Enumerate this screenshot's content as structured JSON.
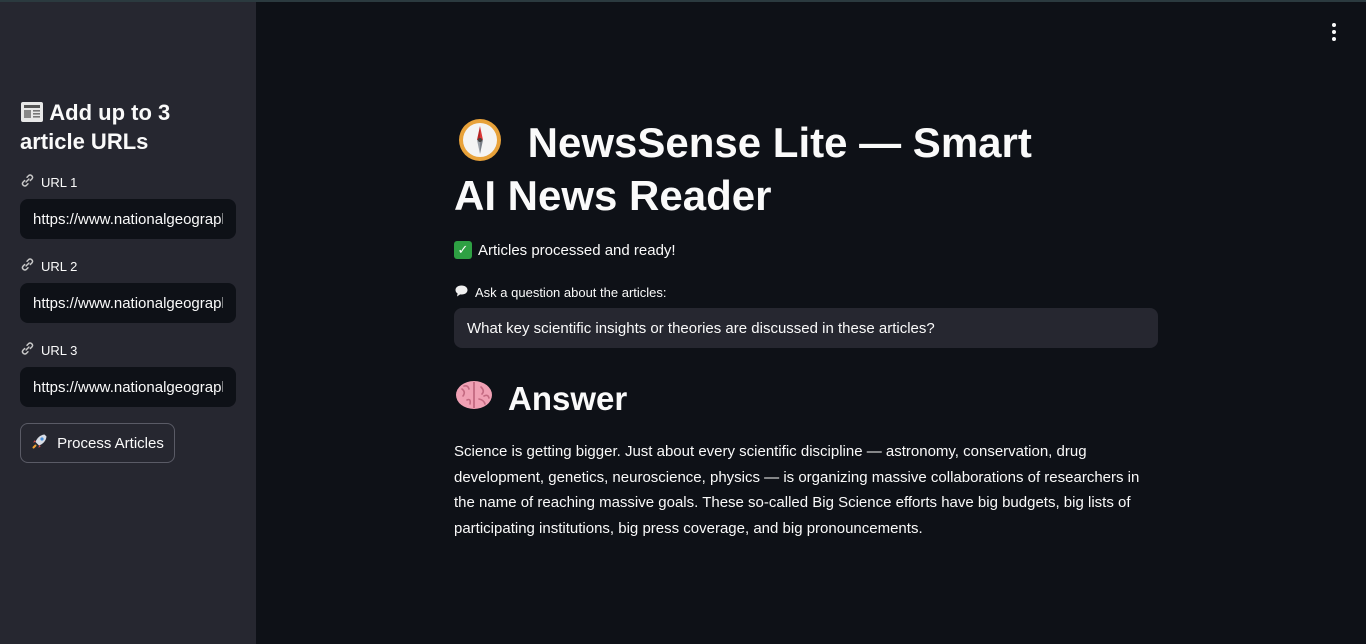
{
  "sidebar": {
    "heading_icon": "newspaper-icon",
    "heading": "Add up to 3 article URLs",
    "url_icon": "link-icon",
    "urls": [
      {
        "label": "URL 1",
        "value": "https://www.nationalgeographic.com"
      },
      {
        "label": "URL 2",
        "value": "https://www.nationalgeographic.com"
      },
      {
        "label": "URL 3",
        "value": "https://www.nationalgeographic.com"
      }
    ],
    "process_button": {
      "icon": "rocket-icon",
      "label": "Process Articles"
    }
  },
  "header": {
    "menu_icon": "kebab-menu-icon"
  },
  "main": {
    "title_icon": "compass-icon",
    "title": "NewsSense Lite — Smart AI News Reader",
    "status": {
      "icon": "check-icon",
      "text": "Articles processed and ready!"
    },
    "question": {
      "icon": "speech-bubble-icon",
      "label": "Ask a question about the articles:",
      "value": "What key scientific insights or theories are discussed in these articles?"
    },
    "answer": {
      "icon": "brain-icon",
      "heading": "Answer",
      "text": "Science is getting bigger. Just about every scientific discipline — astronomy, conservation, drug development, genetics, neuroscience, physics — is organizing massive collaborations of researchers in the name of reaching massive goals. These so-called Big Science efforts have big budgets, big lists of participating institutions, big press coverage, and big pronouncements."
    }
  },
  "colors": {
    "background": "#0e1117",
    "sidebar": "#262730",
    "text": "#fafafa",
    "success": "#2ea043"
  }
}
